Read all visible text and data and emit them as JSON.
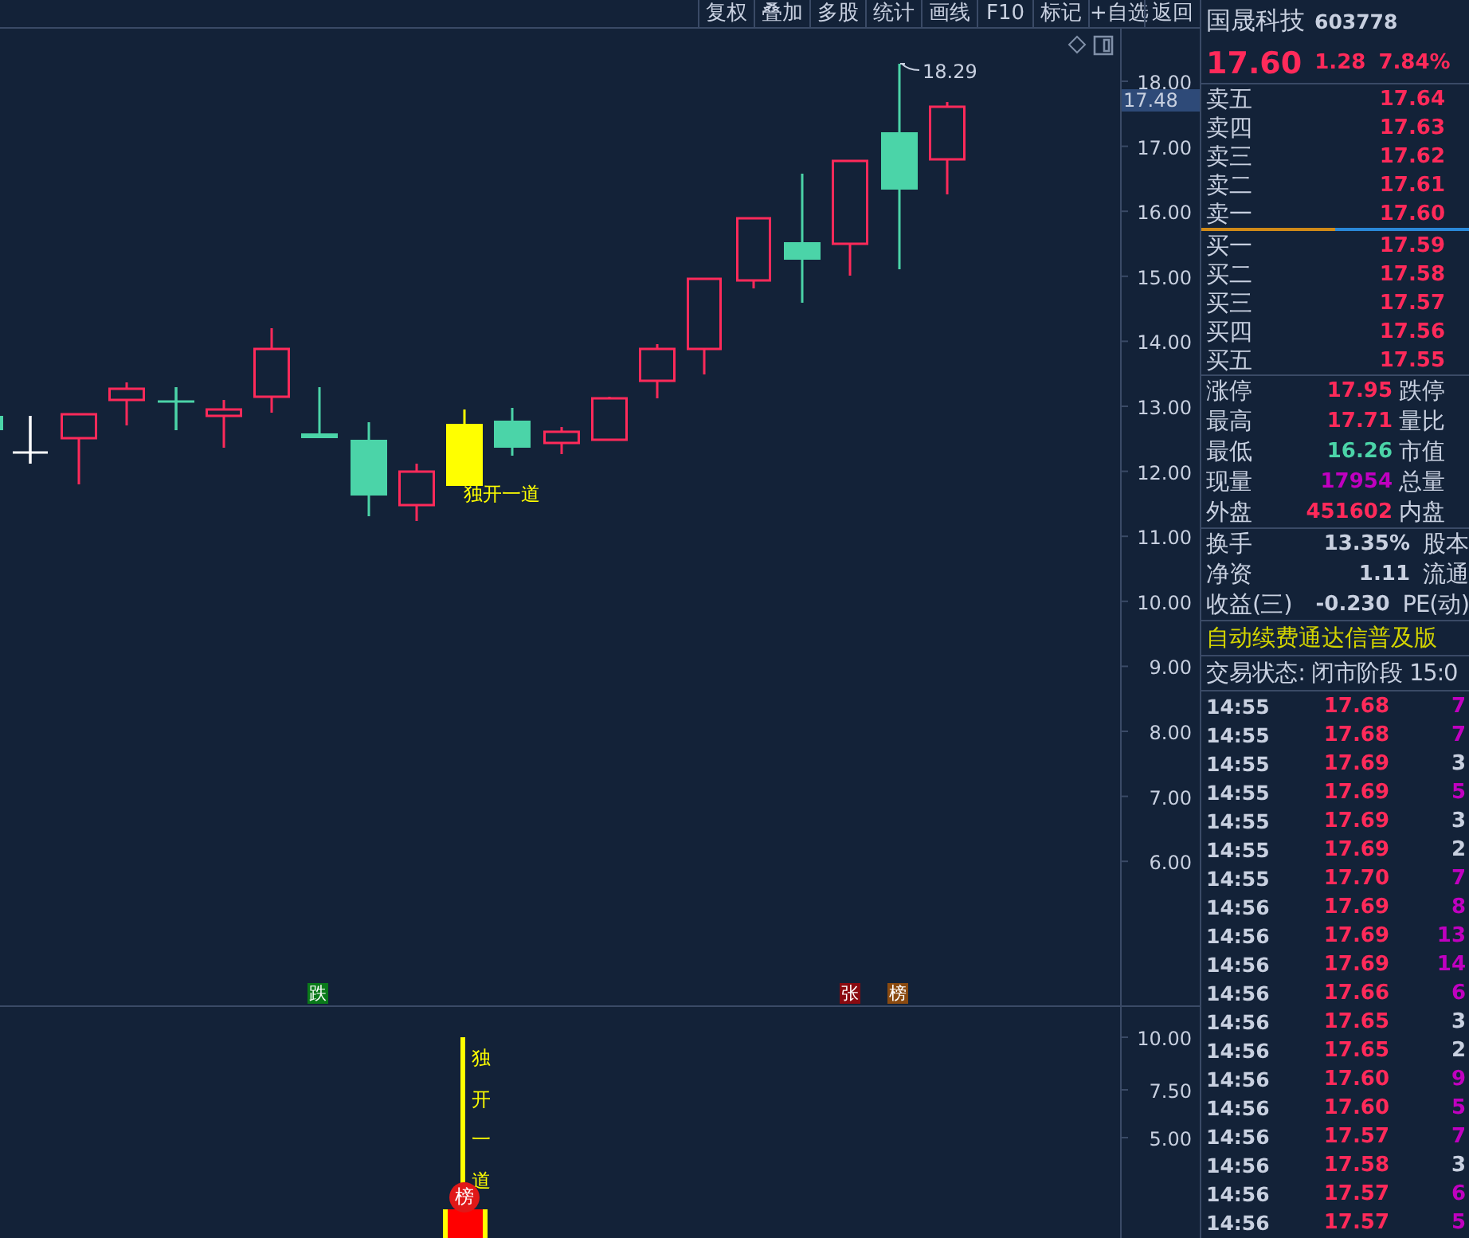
{
  "toolbar": {
    "buttons": [
      "复权",
      "叠加",
      "多股",
      "统计",
      "画线",
      "F10",
      "标记",
      "+自选",
      "返回"
    ]
  },
  "chart": {
    "y_axis": [
      "18.00",
      "17.00",
      "16.00",
      "15.00",
      "14.00",
      "13.00",
      "12.00",
      "11.00",
      "10.00",
      "9.00",
      "8.00",
      "7.00",
      "6.00"
    ],
    "current_price_tag": "17.48",
    "high_label": "18.29",
    "pattern_label": "独开一道",
    "markers": [
      {
        "text": "跌",
        "color": "#0a7a1a"
      },
      {
        "text": "张",
        "color": "#8a0a10"
      },
      {
        "text": "榜",
        "color": "#8a4a10"
      }
    ]
  },
  "indicator": {
    "y_axis": [
      "10.00",
      "7.50",
      "5.00"
    ],
    "label": "独开一道",
    "badge": "榜"
  },
  "quote": {
    "name": "国晟科技",
    "code": "603778",
    "price": "17.60",
    "change": "1.28",
    "change_pct": "7.84%",
    "asks": [
      {
        "label": "卖五",
        "price": "17.64"
      },
      {
        "label": "卖四",
        "price": "17.63"
      },
      {
        "label": "卖三",
        "price": "17.62"
      },
      {
        "label": "卖二",
        "price": "17.61"
      },
      {
        "label": "卖一",
        "price": "17.60"
      }
    ],
    "bids": [
      {
        "label": "买一",
        "price": "17.59"
      },
      {
        "label": "买二",
        "price": "17.58"
      },
      {
        "label": "买三",
        "price": "17.57"
      },
      {
        "label": "买四",
        "price": "17.56"
      },
      {
        "label": "买五",
        "price": "17.55"
      }
    ],
    "stats": [
      {
        "label": "涨停",
        "value": "17.95",
        "color": "#ff2a5a",
        "label2": "跌停"
      },
      {
        "label": "最高",
        "value": "17.71",
        "color": "#ff2a5a",
        "label2": "量比"
      },
      {
        "label": "最低",
        "value": "16.26",
        "color": "#4bd4a8",
        "label2": "市值"
      },
      {
        "label": "现量",
        "value": "17954",
        "color": "#c000c0",
        "label2": "总量"
      },
      {
        "label": "外盘",
        "value": "451602",
        "color": "#ff2a5a",
        "label2": "内盘"
      }
    ],
    "fundamentals": [
      {
        "label": "换手",
        "value": "13.35%",
        "label2": "股本"
      },
      {
        "label": "净资",
        "value": "1.11",
        "label2": "流通"
      },
      {
        "label": "收益(三)",
        "value": "-0.230",
        "label2": "PE(动)"
      }
    ],
    "notice": "自动续费通达信普及版",
    "status": "交易状态: 闭市阶段 15:0",
    "ticks": [
      {
        "time": "14:55",
        "price": "17.68",
        "volume": "7",
        "color": "#c000c0"
      },
      {
        "time": "14:55",
        "price": "17.68",
        "volume": "7",
        "color": "#c000c0"
      },
      {
        "time": "14:55",
        "price": "17.69",
        "volume": "3",
        "color": "#c8d0e0"
      },
      {
        "time": "14:55",
        "price": "17.69",
        "volume": "5",
        "color": "#c000c0"
      },
      {
        "time": "14:55",
        "price": "17.69",
        "volume": "3",
        "color": "#c8d0e0"
      },
      {
        "time": "14:55",
        "price": "17.69",
        "volume": "2",
        "color": "#c8d0e0"
      },
      {
        "time": "14:55",
        "price": "17.70",
        "volume": "7",
        "color": "#c000c0"
      },
      {
        "time": "14:56",
        "price": "17.69",
        "volume": "8",
        "color": "#c000c0"
      },
      {
        "time": "14:56",
        "price": "17.69",
        "volume": "13",
        "color": "#c000c0"
      },
      {
        "time": "14:56",
        "price": "17.69",
        "volume": "14",
        "color": "#c000c0"
      },
      {
        "time": "14:56",
        "price": "17.66",
        "volume": "6",
        "color": "#c000c0"
      },
      {
        "time": "14:56",
        "price": "17.65",
        "volume": "3",
        "color": "#c8d0e0"
      },
      {
        "time": "14:56",
        "price": "17.65",
        "volume": "2",
        "color": "#c8d0e0"
      },
      {
        "time": "14:56",
        "price": "17.60",
        "volume": "9",
        "color": "#c000c0"
      },
      {
        "time": "14:56",
        "price": "17.60",
        "volume": "5",
        "color": "#c000c0"
      },
      {
        "time": "14:56",
        "price": "17.57",
        "volume": "7",
        "color": "#c000c0"
      },
      {
        "time": "14:56",
        "price": "17.58",
        "volume": "3",
        "color": "#c8d0e0"
      },
      {
        "time": "14:56",
        "price": "17.57",
        "volume": "6",
        "color": "#c000c0"
      },
      {
        "time": "14:56",
        "price": "17.57",
        "volume": "5",
        "color": "#c000c0"
      }
    ]
  }
}
